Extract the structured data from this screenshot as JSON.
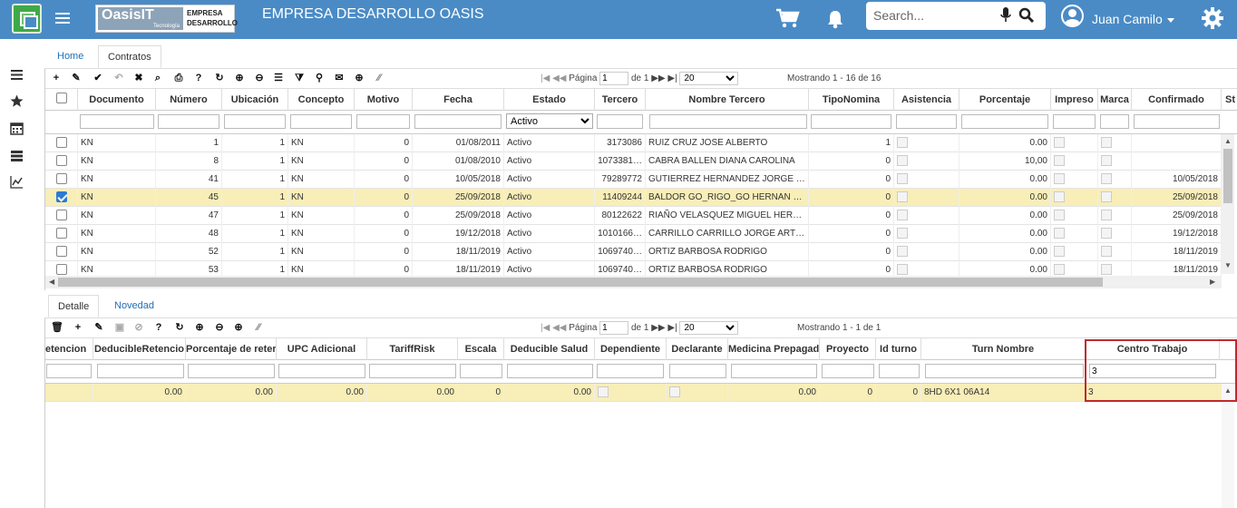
{
  "header": {
    "company": "EMPRESA DESARROLLO OASIS",
    "logo_brand": "OasisIT",
    "logo_sub": "Tecnología",
    "logo_text1": "EMPRESA",
    "logo_text2": "DESARROLLO",
    "search_placeholder": "Search...",
    "user_name": "Juan Camilo",
    "colors": {
      "bar": "#4a8bc6",
      "app": "#3fa94a"
    }
  },
  "tabs": [
    {
      "label": "Home"
    },
    {
      "label": "Contratos De Nomina -[ncnt]",
      "close": "×"
    }
  ],
  "top_grid": {
    "pager": {
      "label": "Página",
      "page": "1",
      "of": "de 1",
      "size": "20",
      "showing": "Mostrando 1 - 16 de 16"
    },
    "columns": [
      "Documento",
      "Número",
      "Ubicación",
      "Concepto",
      "Motivo",
      "Fecha",
      "Estado",
      "Tercero",
      "Nombre Tercero",
      "TipoNomina",
      "Asistencia",
      "Porcentaje",
      "Impreso",
      "Marca",
      "Confirmado",
      "St"
    ],
    "estado_filter": "Activo",
    "rows": [
      {
        "doc": "KN",
        "num": "1",
        "ubi": "1",
        "con": "KN",
        "mot": "0",
        "fecha": "01/08/2011",
        "estado": "Activo",
        "tercero": "3173086",
        "nombre": "RUIZ CRUZ JOSE ALBERTO",
        "tipo": "1",
        "pct": "0.00",
        "confirmado": "",
        "checked": false
      },
      {
        "doc": "KN",
        "num": "8",
        "ubi": "1",
        "con": "KN",
        "mot": "0",
        "fecha": "01/08/2010",
        "estado": "Activo",
        "tercero": "1073381…",
        "nombre": "CABRA BALLEN DIANA CAROLINA",
        "tipo": "0",
        "pct": "10,00",
        "confirmado": "",
        "checked": false
      },
      {
        "doc": "KN",
        "num": "41",
        "ubi": "1",
        "con": "KN",
        "mot": "0",
        "fecha": "10/05/2018",
        "estado": "Activo",
        "tercero": "79289772",
        "nombre": "GUTIERREZ HERNANDEZ JORGE …",
        "tipo": "0",
        "pct": "0.00",
        "confirmado": "10/05/2018",
        "checked": false
      },
      {
        "doc": "KN",
        "num": "45",
        "ubi": "1",
        "con": "KN",
        "mot": "0",
        "fecha": "25/09/2018",
        "estado": "Activo",
        "tercero": "11409244",
        "nombre": "BALDOR GO_RIGO_GO HERNAN …",
        "tipo": "0",
        "pct": "0.00",
        "confirmado": "25/09/2018",
        "checked": true
      },
      {
        "doc": "KN",
        "num": "47",
        "ubi": "1",
        "con": "KN",
        "mot": "0",
        "fecha": "25/09/2018",
        "estado": "Activo",
        "tercero": "80122622",
        "nombre": "RIAÑO VELASQUEZ MIGUEL HER…",
        "tipo": "0",
        "pct": "0.00",
        "confirmado": "25/09/2018",
        "checked": false
      },
      {
        "doc": "KN",
        "num": "48",
        "ubi": "1",
        "con": "KN",
        "mot": "0",
        "fecha": "19/12/2018",
        "estado": "Activo",
        "tercero": "1010166…",
        "nombre": "CARRILLO CARRILLO JORGE ART…",
        "tipo": "0",
        "pct": "0.00",
        "confirmado": "19/12/2018",
        "checked": false
      },
      {
        "doc": "KN",
        "num": "52",
        "ubi": "1",
        "con": "KN",
        "mot": "0",
        "fecha": "18/11/2019",
        "estado": "Activo",
        "tercero": "1069740…",
        "nombre": "ORTIZ BARBOSA RODRIGO",
        "tipo": "0",
        "pct": "0.00",
        "confirmado": "18/11/2019",
        "checked": false
      },
      {
        "doc": "KN",
        "num": "53",
        "ubi": "1",
        "con": "KN",
        "mot": "0",
        "fecha": "18/11/2019",
        "estado": "Activo",
        "tercero": "1069740…",
        "nombre": "ORTIZ BARBOSA RODRIGO",
        "tipo": "0",
        "pct": "0.00",
        "confirmado": "18/11/2019",
        "checked": false
      }
    ]
  },
  "detail_tabs": [
    {
      "label": "Detalle"
    },
    {
      "label": "Novedad"
    }
  ],
  "bottom_grid": {
    "pager": {
      "label": "Página",
      "page": "1",
      "of": "de 1",
      "size": "20",
      "showing": "Mostrando 1 - 1 de 1"
    },
    "columns": [
      "etencion",
      "DeducibleRetencio",
      "Porcentaje de reter",
      "UPC Adicional",
      "TariffRisk",
      "Escala",
      "Deducible Salud",
      "Dependiente",
      "Declarante",
      "Medicina Prepagad",
      "Proyecto",
      "Id turno",
      "Turn Nombre",
      "Centro Trabajo"
    ],
    "filter_centro": "3",
    "row": {
      "dedret": "0.00",
      "pctret": "0.00",
      "upc": "0.00",
      "tariff": "0.00",
      "escala": "0",
      "dedsal": "0.00",
      "medicina": "0.00",
      "proyecto": "0",
      "idturno": "0",
      "turno": "8HD 6X1 06A14",
      "centro": "3"
    }
  }
}
